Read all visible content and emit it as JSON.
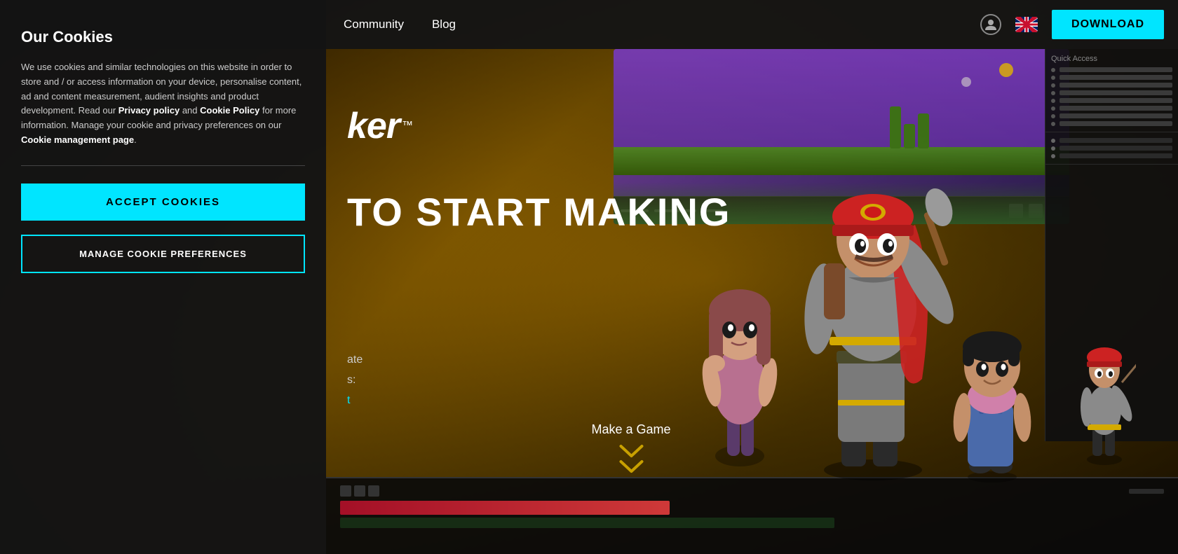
{
  "navbar": {
    "community_label": "Community",
    "blog_label": "Blog",
    "download_label": "DOWNLOAD"
  },
  "cookie": {
    "title": "Our Cookies",
    "body": "We use cookies and similar technologies on this website in order to store and / or access information on your device, personalise content, ad and content measurement, audient insights and product development. Read our ",
    "privacy_policy_link": "Privacy policy",
    "and_text": " and ",
    "cookie_policy_link": "Cookie Policy",
    "suffix_text": " for more information. Manage your cookie and privacy preferences on our ",
    "cookie_management_link": "Cookie management page",
    "period": ".",
    "accept_label": "ACCEPT COOKIES",
    "manage_label": "MANAGE COOKIE PREFERENCES"
  },
  "hero": {
    "logo_text": "ker",
    "logo_tm": "™",
    "headline": "TO START MAKING",
    "sub_line1": "ate",
    "sub_line2": "s:",
    "sub_link": "t",
    "make_game_label": "Make a Game",
    "chevron": "❯❯"
  },
  "colors": {
    "accent": "#00e5ff",
    "gold": "#c8a000",
    "background": "#1a1a1a"
  }
}
